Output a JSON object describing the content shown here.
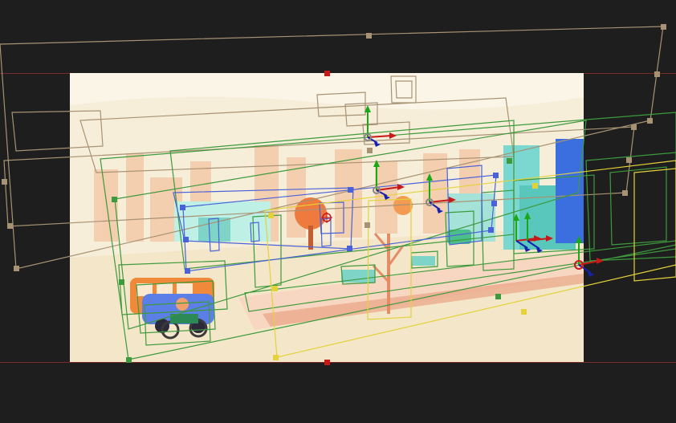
{
  "app": {
    "panel": "composition-viewer"
  },
  "colors": {
    "pasteboard": "#1e1e1e",
    "comp_background": "#f6ecd6",
    "guide_line": "#7a2a2a",
    "layer_brown": "#a89274",
    "layer_green": "#3d9a3d",
    "layer_blue": "#4a62d8",
    "layer_yellow": "#e3d23a",
    "axis_x": "#c81818",
    "axis_y": "#18a818",
    "axis_z": "#1420b0"
  },
  "icons": {
    "transform_gizmo": "3d-transform-axes-icon",
    "anchor_point": "anchor-point-icon",
    "camera_target": "camera-target-icon"
  }
}
